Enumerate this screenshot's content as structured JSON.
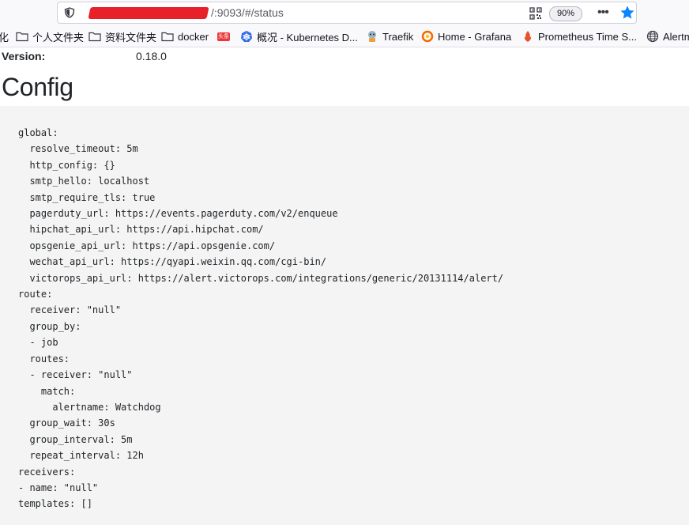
{
  "browser": {
    "url_visible": "/:9093/#/status",
    "zoom": "90%",
    "bookmarks": [
      {
        "label": "化",
        "icon": "partial"
      },
      {
        "label": "个人文件夹",
        "icon": "folder-icon"
      },
      {
        "label": "资料文件夹",
        "icon": "folder-icon"
      },
      {
        "label": "docker",
        "icon": "folder-icon"
      },
      {
        "label": "头条",
        "icon": "toutiao-icon"
      },
      {
        "label": "概况 - Kubernetes D...",
        "icon": "kubernetes-icon"
      },
      {
        "label": "Traefik",
        "icon": "traefik-icon"
      },
      {
        "label": "Home - Grafana",
        "icon": "grafana-icon"
      },
      {
        "label": "Prometheus Time S...",
        "icon": "prometheus-icon"
      },
      {
        "label": "Alertm",
        "icon": "globe-icon"
      }
    ]
  },
  "page": {
    "version_label": "Version:",
    "version_value": "0.18.0",
    "config_title": "Config",
    "config_text": "global:\n  resolve_timeout: 5m\n  http_config: {}\n  smtp_hello: localhost\n  smtp_require_tls: true\n  pagerduty_url: https://events.pagerduty.com/v2/enqueue\n  hipchat_api_url: https://api.hipchat.com/\n  opsgenie_api_url: https://api.opsgenie.com/\n  wechat_api_url: https://qyapi.weixin.qq.com/cgi-bin/\n  victorops_api_url: https://alert.victorops.com/integrations/generic/20131114/alert/\nroute:\n  receiver: \"null\"\n  group_by:\n  - job\n  routes:\n  - receiver: \"null\"\n    match:\n      alertname: Watchdog\n  group_wait: 30s\n  group_interval: 5m\n  repeat_interval: 12h\nreceivers:\n- name: \"null\"\ntemplates: []"
  }
}
